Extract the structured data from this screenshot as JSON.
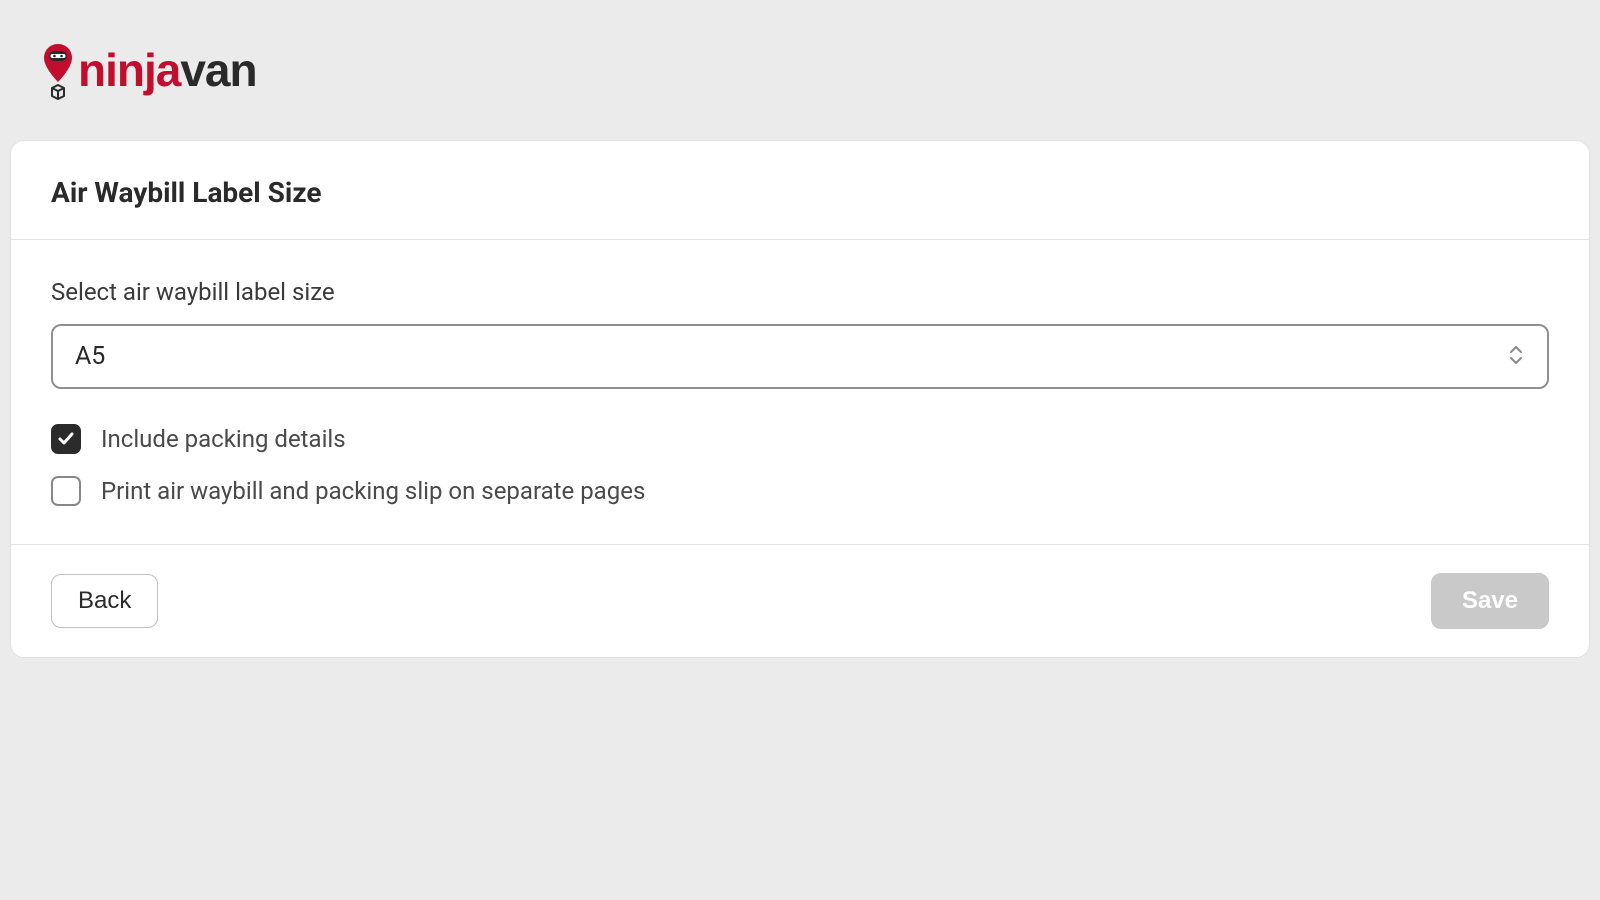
{
  "logo": {
    "brand_part1": "ninja",
    "brand_part2": "van",
    "color_primary": "#c20e2e",
    "color_secondary": "#2a2a2a"
  },
  "card": {
    "title": "Air Waybill Label Size",
    "field_label": "Select air waybill label size",
    "select_value": "A5",
    "checkboxes": [
      {
        "label": "Include packing details",
        "checked": true
      },
      {
        "label": "Print air waybill and packing slip on separate pages",
        "checked": false
      }
    ],
    "back_label": "Back",
    "save_label": "Save"
  }
}
